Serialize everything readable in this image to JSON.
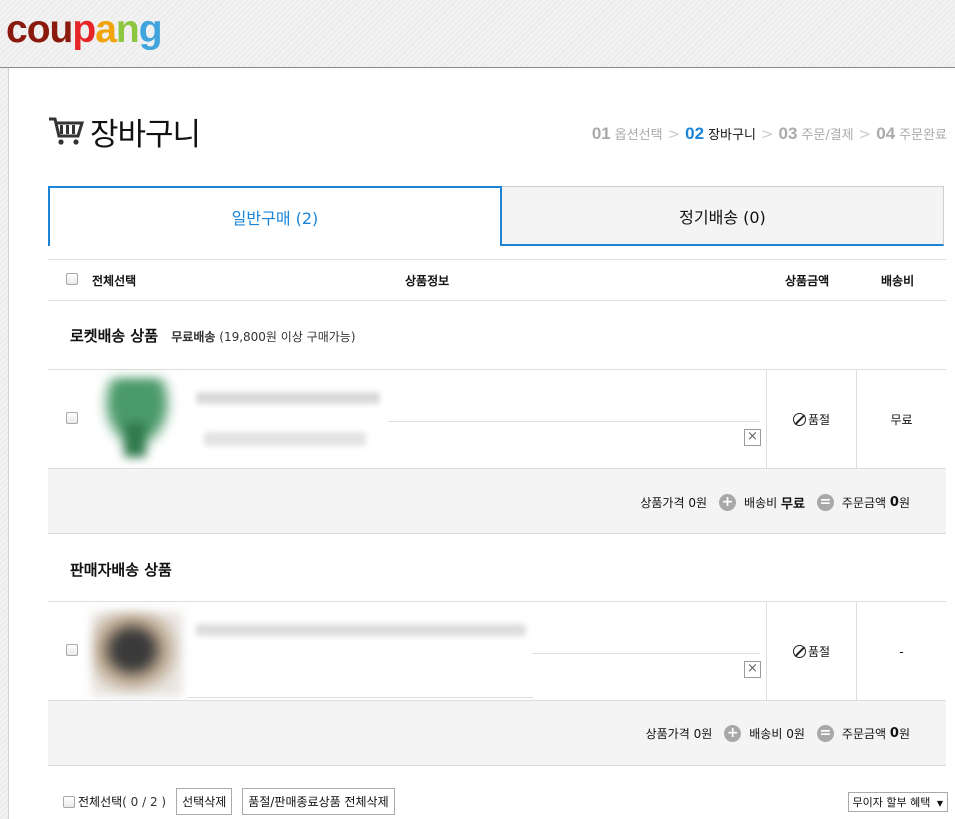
{
  "brand": {
    "letters": [
      {
        "ch": "c",
        "color": "#8a1a0e"
      },
      {
        "ch": "o",
        "color": "#8a1a0e"
      },
      {
        "ch": "u",
        "color": "#8a1a0e"
      },
      {
        "ch": "p",
        "color": "#e52528"
      },
      {
        "ch": "a",
        "color": "#f0a30a"
      },
      {
        "ch": "n",
        "color": "#8dc63f"
      },
      {
        "ch": "g",
        "color": "#41a4dc"
      }
    ]
  },
  "page": {
    "title": "장바구니",
    "cart_icon": "shopping-cart-icon"
  },
  "steps": [
    {
      "num": "01",
      "label": "옵션선택",
      "active": false
    },
    {
      "num": "02",
      "label": "장바구니",
      "active": true
    },
    {
      "num": "03",
      "label": "주문/결제",
      "active": false
    },
    {
      "num": "04",
      "label": "주문완료",
      "active": false
    }
  ],
  "tabs": {
    "normal": "일반구매 (2)",
    "regular": "정기배송 (0)"
  },
  "table_header": {
    "select_all": "전체선택",
    "product_info": "상품정보",
    "price": "상품금액",
    "shipping": "배송비"
  },
  "sections": {
    "rocket": {
      "title": "로켓배송 상품",
      "free_label": "무료배송",
      "free_note": "(19,800원 이상 구매가능)",
      "price_status": "품절",
      "shipping": "무료",
      "summary": {
        "price_label": "상품가격",
        "price_value": "0원",
        "ship_label": "배송비",
        "ship_value": "무료",
        "total_label": "주문금액",
        "total_value": "0",
        "total_unit": "원"
      }
    },
    "seller": {
      "title": "판매자배송 상품",
      "price_status": "품절",
      "shipping": "-",
      "summary": {
        "price_label": "상품가격",
        "price_value": "0원",
        "ship_label": "배송비",
        "ship_value": "0원",
        "total_label": "주문금액",
        "total_value": "0",
        "total_unit": "원"
      }
    }
  },
  "bottom": {
    "select_all": "전체선택",
    "count": "( 0 / 2 )",
    "delete_selected": "선택삭제",
    "delete_soldout": "품절/판매종료상품 전체삭제",
    "installment": "무이자 할부 혜택"
  },
  "colors": {
    "accent": "#1b84d7",
    "summary_bg": "#f4f4f4"
  }
}
